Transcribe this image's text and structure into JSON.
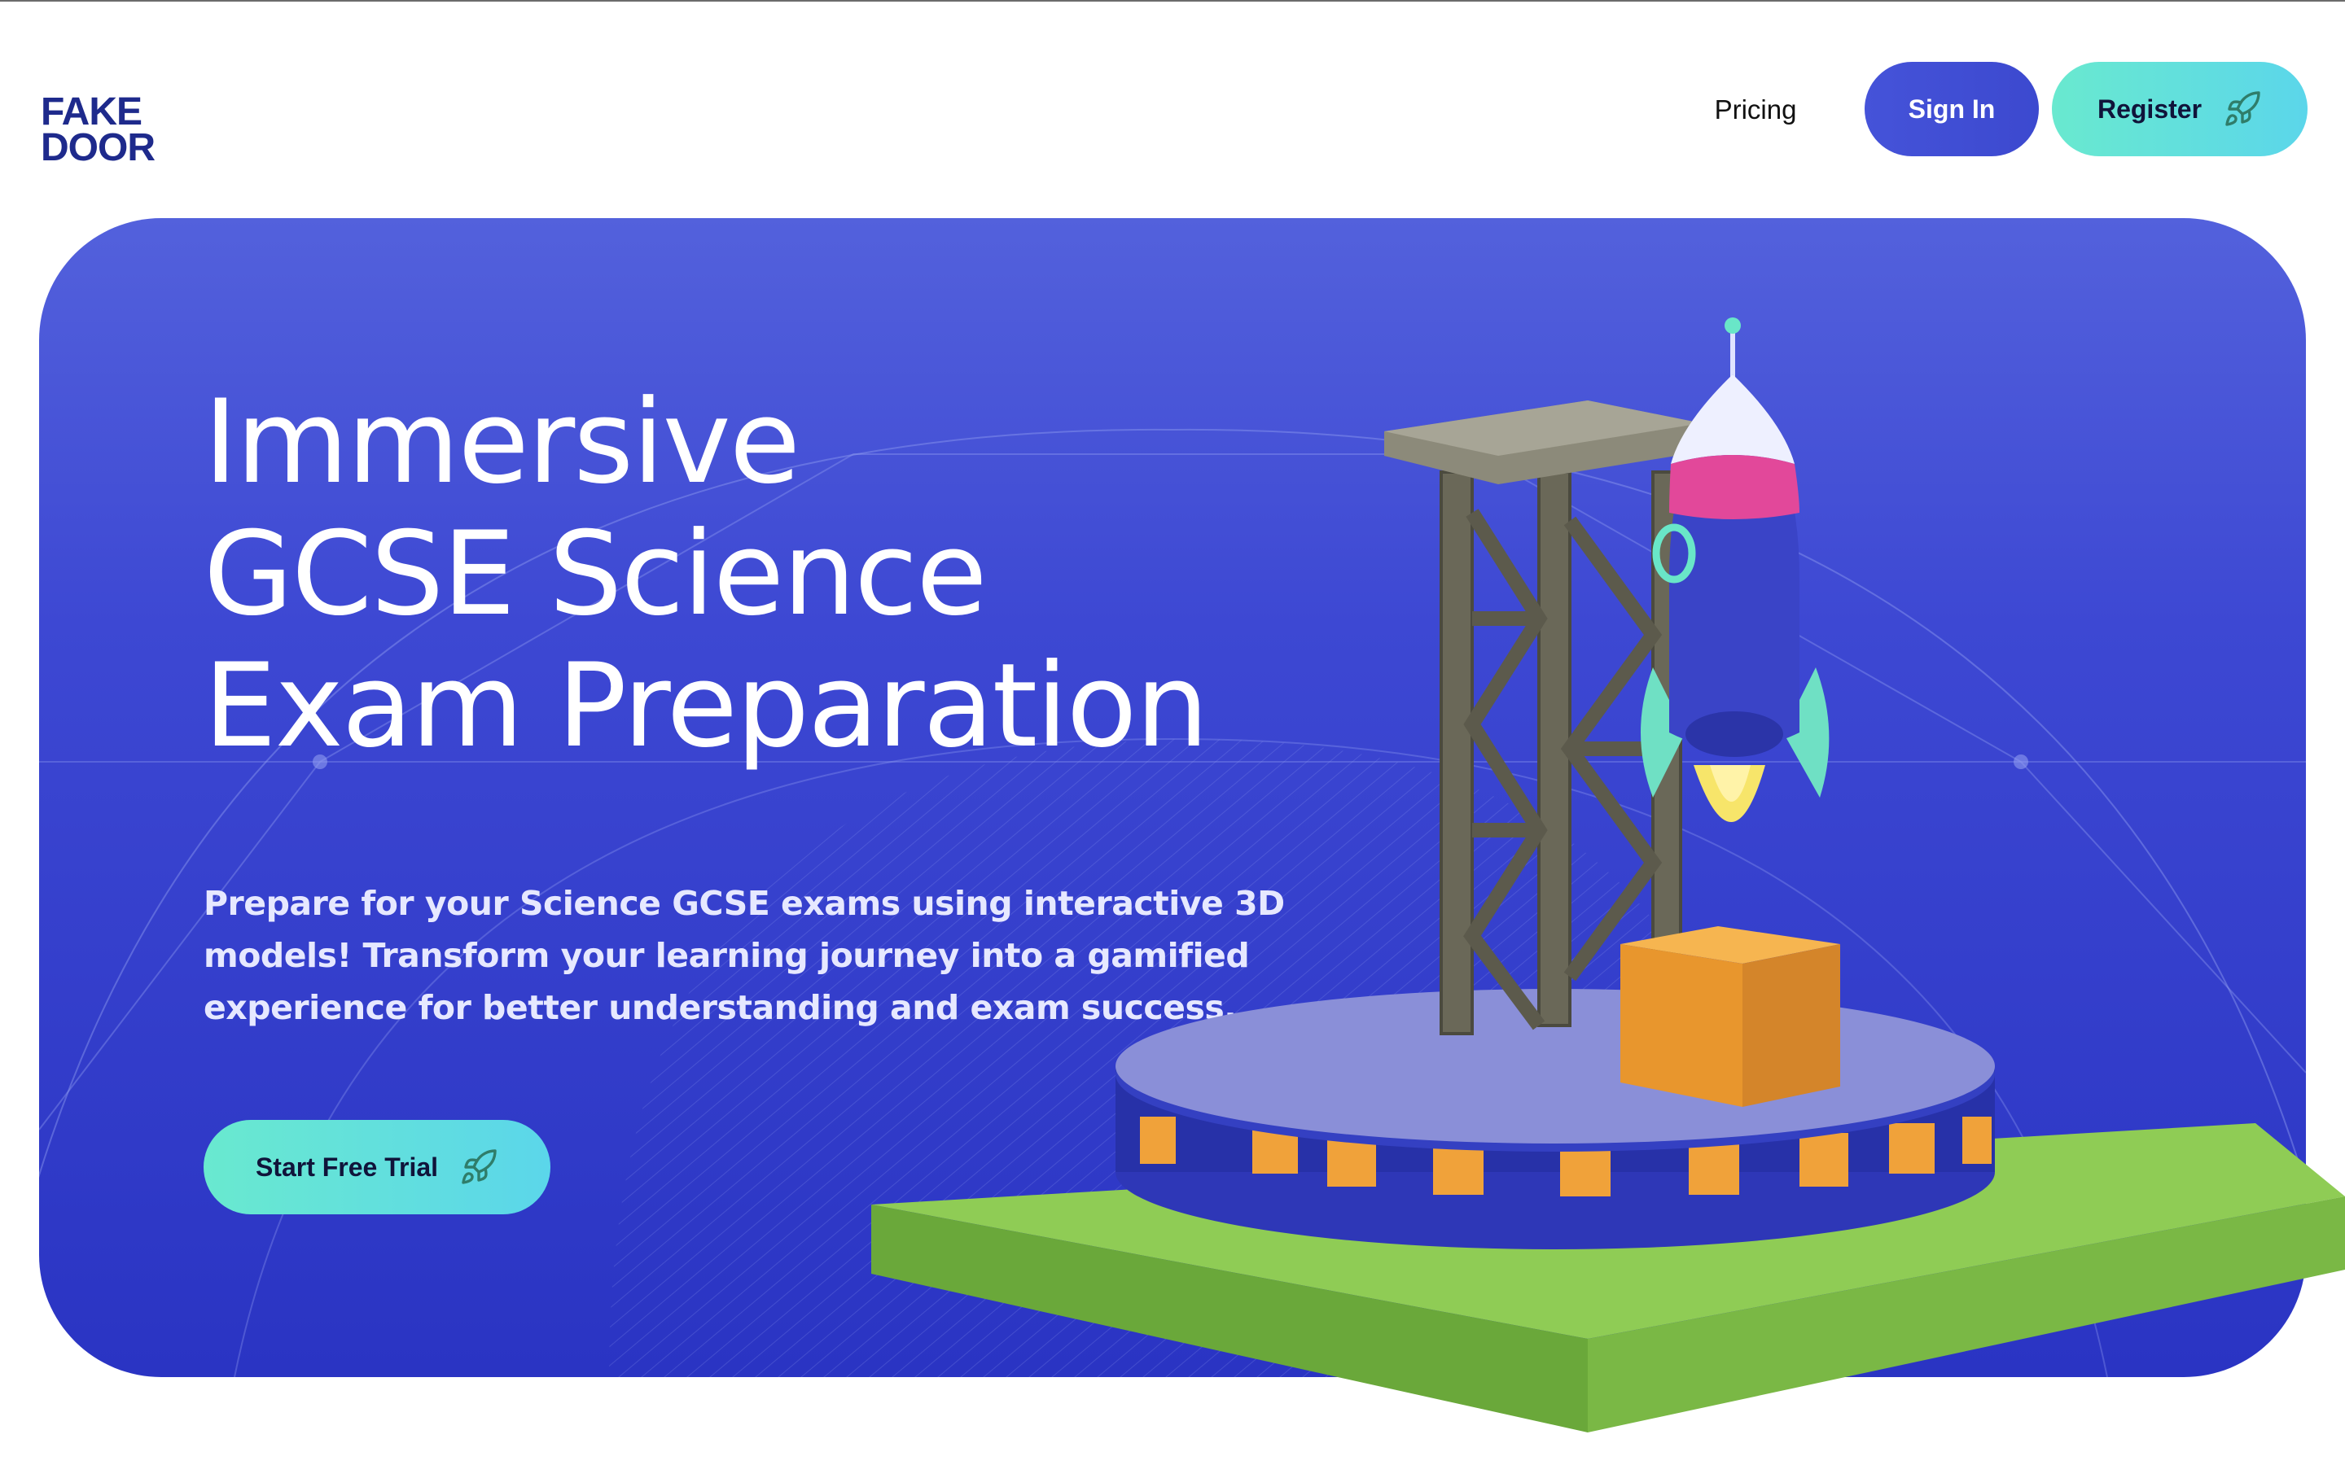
{
  "logo": {
    "line1": "FAKE",
    "line2": "DOOR"
  },
  "nav": {
    "pricing_label": "Pricing",
    "signin_label": "Sign In",
    "register_label": "Register"
  },
  "hero": {
    "title_lines": [
      "Immersive",
      "GCSE Science",
      "Exam Preparation"
    ],
    "description": "Prepare for your Science GCSE exams using interactive 3D models! Transform your learning journey into a gamified experience for better understanding and exam success.",
    "cta_label": "Start Free Trial"
  },
  "icons": {
    "logo": "key-icon",
    "register": "rocket-icon",
    "cta": "rocket-icon"
  },
  "colors": {
    "brand_navy": "#1e2a8c",
    "brand_teal": "#3dd9a8",
    "primary_blue": "#4553d9",
    "accent_gradient": [
      "#69e9cf",
      "#5bd6ea"
    ],
    "hero_top": "#5361dc",
    "hero_bottom": "#2a34c3"
  }
}
